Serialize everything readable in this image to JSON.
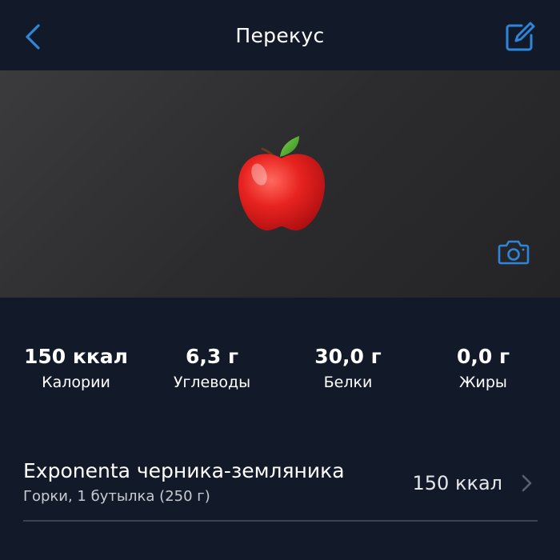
{
  "header": {
    "title": "Перекус",
    "back_icon": "chevron-left-icon",
    "edit_icon": "edit-icon"
  },
  "photo": {
    "image": "red-apple",
    "camera_icon": "camera-icon"
  },
  "macros": [
    {
      "value": "150 ккал",
      "label": "Калории"
    },
    {
      "value": "6,3 г",
      "label": "Углеводы"
    },
    {
      "value": "30,0 г",
      "label": "Белки"
    },
    {
      "value": "0,0 г",
      "label": "Жиры"
    }
  ],
  "food_item": {
    "name": "Exponenta черника-земляника",
    "details": "Горки, 1 бутылка (250 г)",
    "calories": "150 ккал",
    "chevron_icon": "chevron-right-icon"
  },
  "colors": {
    "background": "#121a2a",
    "accent": "#2d86d9",
    "photo_bg": "#2c2c2e",
    "divider": "#3a4354"
  }
}
